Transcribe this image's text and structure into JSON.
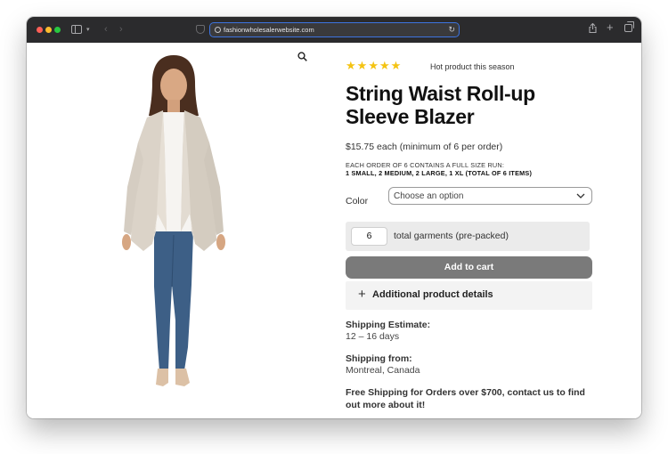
{
  "browser": {
    "url": "fashionwholesalerwebsite.com"
  },
  "product": {
    "rating_stars": 5,
    "badge_text": "Hot product this season",
    "title": "String Waist Roll-up Sleeve Blazer",
    "price_text": "$15.75 each (minimum of 6 per order)",
    "size_run_heading": "EACH ORDER OF 6 CONTAINS A FULL SIZE RUN:",
    "size_run_detail": "1 SMALL, 2 MEDIUM, 2 LARGE, 1 XL (TOTAL OF 6 ITEMS)",
    "color_label": "Color",
    "color_placeholder": "Choose an option",
    "quantity_value": "6",
    "quantity_label": "total garments (pre-packed)",
    "add_to_cart_label": "Add to cart",
    "additional_details_label": "Additional product details",
    "shipping_estimate_title": "Shipping Estimate:",
    "shipping_estimate_value": "12 – 16 days",
    "shipping_from_title": "Shipping from:",
    "shipping_from_value": "Montreal, Canada",
    "free_shipping_note": "Free Shipping for Orders over $700, contact us to find out more about it!"
  },
  "icons": {
    "star_color": "#f4c312",
    "button_color": "#7a7a7a"
  }
}
